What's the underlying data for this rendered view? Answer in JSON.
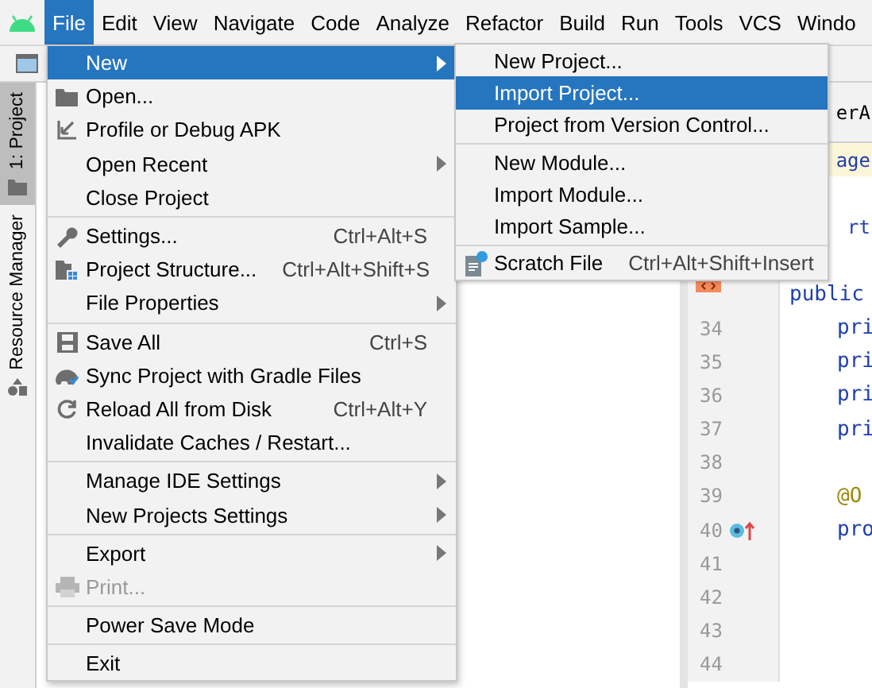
{
  "menu_bar": [
    {
      "label": "File",
      "selected": true
    },
    {
      "label": "Edit",
      "selected": false
    },
    {
      "label": "View",
      "selected": false
    },
    {
      "label": "Navigate",
      "selected": false
    },
    {
      "label": "Code",
      "selected": false
    },
    {
      "label": "Analyze",
      "selected": false
    },
    {
      "label": "Refactor",
      "selected": false
    },
    {
      "label": "Build",
      "selected": false
    },
    {
      "label": "Run",
      "selected": false
    },
    {
      "label": "Tools",
      "selected": false
    },
    {
      "label": "VCS",
      "selected": false
    },
    {
      "label": "Windo",
      "selected": false
    }
  ],
  "side_tabs": [
    {
      "label": "1: Project",
      "selected": true
    },
    {
      "label": "Resource Manager",
      "selected": false
    }
  ],
  "editor": {
    "tab": "erA",
    "lines": [
      {
        "code": "age",
        "kind": "covered",
        "highlighted": true
      },
      {
        "kind": "covered",
        "highlighted": false
      },
      {
        "code": "rt",
        "kind": "covered",
        "highlighted": false
      },
      {
        "kind": "covered",
        "highlighted": false
      },
      {
        "code": "public",
        "kind": "top",
        "highlighted": false
      },
      {
        "number": "34",
        "code": "pri",
        "kind": "member",
        "highlighted": false
      },
      {
        "number": "35",
        "code": "pri",
        "kind": "member",
        "highlighted": false
      },
      {
        "number": "36",
        "code": "pri",
        "kind": "member",
        "highlighted": false
      },
      {
        "number": "37",
        "code": "pri",
        "kind": "member",
        "highlighted": false
      },
      {
        "number": "38",
        "kind": "member",
        "highlighted": false
      },
      {
        "number": "39",
        "code": "@O",
        "kind": "annotation",
        "highlighted": false
      },
      {
        "number": "40",
        "code": "pro",
        "kind": "member",
        "highlighted": false
      },
      {
        "number": "41",
        "kind": "member",
        "highlighted": false
      },
      {
        "number": "42",
        "kind": "member",
        "highlighted": false
      },
      {
        "number": "43",
        "kind": "member",
        "highlighted": false
      },
      {
        "number": "44",
        "kind": "member",
        "highlighted": false
      }
    ]
  },
  "file_menu": {
    "sections": [
      [
        {
          "label": "New",
          "kind": "plain",
          "submenu": true,
          "selected": true,
          "disabled": false
        },
        {
          "label": "Open...",
          "kind": "folder",
          "submenu": false,
          "selected": false,
          "disabled": false
        },
        {
          "label": "Profile or Debug APK",
          "kind": "arrow",
          "submenu": false,
          "selected": false,
          "disabled": false
        },
        {
          "label": "Open Recent",
          "kind": "plain",
          "submenu": true,
          "selected": false,
          "disabled": false
        },
        {
          "label": "Close Project",
          "kind": "plain",
          "submenu": false,
          "selected": false,
          "disabled": false
        }
      ],
      [
        {
          "label": "Settings...",
          "kind": "wrench",
          "shortcut": "Ctrl+Alt+S",
          "submenu": false,
          "selected": false,
          "disabled": false
        },
        {
          "label": "Project Structure...",
          "kind": "structure",
          "shortcut": "Ctrl+Alt+Shift+S",
          "submenu": false,
          "selected": false,
          "disabled": false
        },
        {
          "label": "File Properties",
          "kind": "plain",
          "submenu": true,
          "selected": false,
          "disabled": false
        }
      ],
      [
        {
          "label": "Save All",
          "kind": "save",
          "shortcut": "Ctrl+S",
          "submenu": false,
          "selected": false,
          "disabled": false
        },
        {
          "label": "Sync Project with Gradle Files",
          "kind": "sync",
          "submenu": false,
          "selected": false,
          "disabled": false
        },
        {
          "label": "Reload All from Disk",
          "kind": "reload",
          "shortcut": "Ctrl+Alt+Y",
          "submenu": false,
          "selected": false,
          "disabled": false
        },
        {
          "label": "Invalidate Caches / Restart...",
          "kind": "plain",
          "submenu": false,
          "selected": false,
          "disabled": false
        }
      ],
      [
        {
          "label": "Manage IDE Settings",
          "kind": "plain",
          "submenu": true,
          "selected": false,
          "disabled": false
        },
        {
          "label": "New Projects Settings",
          "kind": "plain",
          "submenu": true,
          "selected": false,
          "disabled": false
        }
      ],
      [
        {
          "label": "Export",
          "kind": "plain",
          "submenu": true,
          "selected": false,
          "disabled": false
        },
        {
          "label": "Print...",
          "kind": "print",
          "submenu": false,
          "selected": false,
          "disabled": true
        }
      ],
      [
        {
          "label": "Power Save Mode",
          "kind": "plain",
          "submenu": false,
          "selected": false,
          "disabled": false
        }
      ],
      [
        {
          "label": "Exit",
          "kind": "plain",
          "submenu": false,
          "selected": false,
          "disabled": false
        }
      ]
    ]
  },
  "new_submenu": {
    "sections": [
      [
        {
          "label": "New Project...",
          "kind": "plain",
          "selected": false
        },
        {
          "label": "Import Project...",
          "kind": "plain",
          "selected": true
        },
        {
          "label": "Project from Version Control...",
          "kind": "plain",
          "selected": false
        }
      ],
      [
        {
          "label": "New Module...",
          "kind": "plain",
          "selected": false
        },
        {
          "label": "Import Module...",
          "kind": "plain",
          "selected": false
        },
        {
          "label": "Import Sample...",
          "kind": "plain",
          "selected": false
        }
      ],
      [
        {
          "label": "Scratch File",
          "kind": "scratch",
          "shortcut": "Ctrl+Alt+Shift+Insert",
          "selected": false
        }
      ]
    ]
  }
}
